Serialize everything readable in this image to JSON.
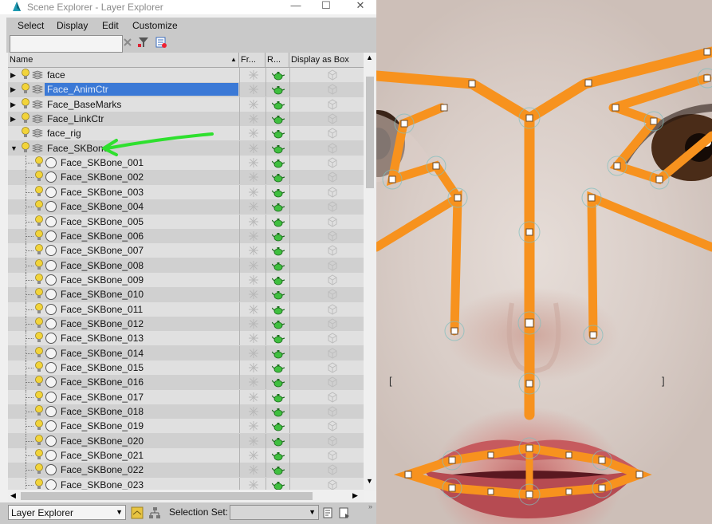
{
  "window": {
    "title": "Scene Explorer - Layer Explorer",
    "controls": {
      "minimize": "—",
      "maximize": "☐",
      "close": "✕"
    }
  },
  "menu": [
    "Select",
    "Display",
    "Edit",
    "Customize"
  ],
  "search": {
    "value": ""
  },
  "columns": {
    "name": "Name",
    "freeze": "Fr...",
    "render": "R...",
    "display_as_box": "Display as Box"
  },
  "layers": [
    {
      "name": "face",
      "type": "layer",
      "expander": "▶",
      "selected": false
    },
    {
      "name": "Face_AnimCtr",
      "type": "layer",
      "expander": "▶",
      "selected": true
    },
    {
      "name": "Face_BaseMarks",
      "type": "layer",
      "expander": "▶",
      "selected": false
    },
    {
      "name": "Face_LinkCtr",
      "type": "layer",
      "expander": "▶",
      "selected": false
    },
    {
      "name": "face_rig",
      "type": "layer",
      "expander": "",
      "selected": false
    },
    {
      "name": "Face_SKBone",
      "type": "layer",
      "expander": "▼",
      "selected": false
    },
    {
      "name": "Face_SKBone_001",
      "type": "object"
    },
    {
      "name": "Face_SKBone_002",
      "type": "object"
    },
    {
      "name": "Face_SKBone_003",
      "type": "object"
    },
    {
      "name": "Face_SKBone_004",
      "type": "object"
    },
    {
      "name": "Face_SKBone_005",
      "type": "object"
    },
    {
      "name": "Face_SKBone_006",
      "type": "object"
    },
    {
      "name": "Face_SKBone_007",
      "type": "object"
    },
    {
      "name": "Face_SKBone_008",
      "type": "object"
    },
    {
      "name": "Face_SKBone_009",
      "type": "object"
    },
    {
      "name": "Face_SKBone_010",
      "type": "object"
    },
    {
      "name": "Face_SKBone_011",
      "type": "object"
    },
    {
      "name": "Face_SKBone_012",
      "type": "object"
    },
    {
      "name": "Face_SKBone_013",
      "type": "object"
    },
    {
      "name": "Face_SKBone_014",
      "type": "object"
    },
    {
      "name": "Face_SKBone_015",
      "type": "object"
    },
    {
      "name": "Face_SKBone_016",
      "type": "object"
    },
    {
      "name": "Face_SKBone_017",
      "type": "object"
    },
    {
      "name": "Face_SKBone_018",
      "type": "object"
    },
    {
      "name": "Face_SKBone_019",
      "type": "object"
    },
    {
      "name": "Face_SKBone_020",
      "type": "object"
    },
    {
      "name": "Face_SKBone_021",
      "type": "object"
    },
    {
      "name": "Face_SKBone_022",
      "type": "object"
    },
    {
      "name": "Face_SKBone_023",
      "type": "object"
    }
  ],
  "statusbar": {
    "explorer_mode": "Layer Explorer",
    "selection_set_label": "Selection Set:",
    "selection_set_value": ""
  },
  "colors": {
    "selection": "#3b79d6",
    "bone": "#f7921e",
    "annotation_arrow": "#2ee02e",
    "render_icon": "#3fbf3f"
  },
  "icons": {
    "lightbulb": "lightbulb-icon",
    "layer": "layer-stack-icon",
    "object": "object-circle-icon",
    "freeze": "snowflake-icon",
    "render": "teapot-icon",
    "box": "box-icon"
  }
}
